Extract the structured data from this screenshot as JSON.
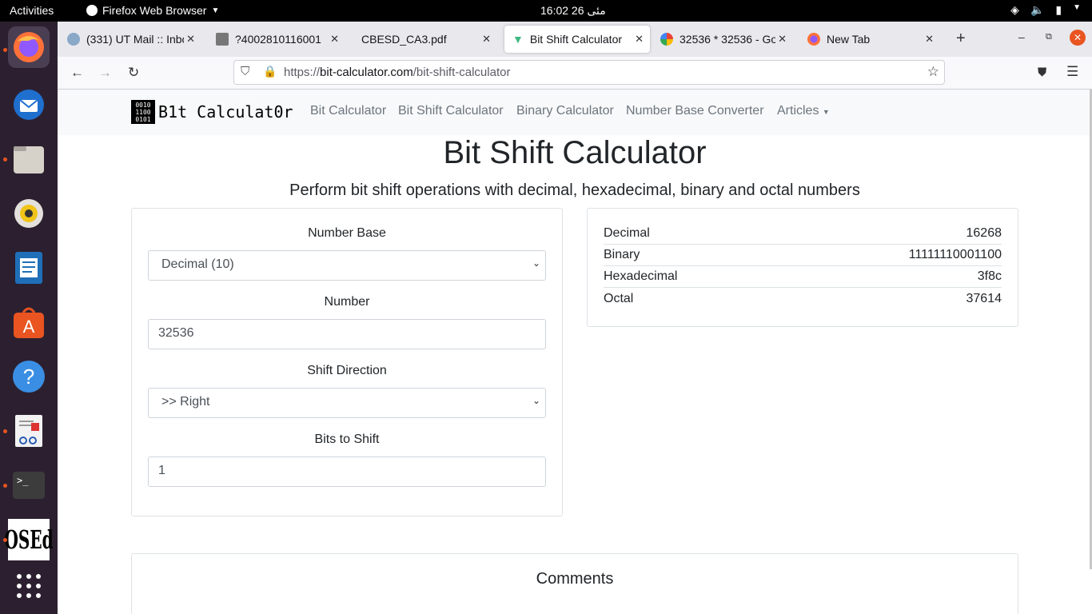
{
  "system": {
    "activities": "Activities",
    "app_name": "Firefox Web Browser",
    "clock": "16:02  26 مئی"
  },
  "tabs": [
    {
      "title": "(331) UT Mail :: Inbo",
      "active": false
    },
    {
      "title": "?4002810116001",
      "active": false
    },
    {
      "title": "CBESD_CA3.pdf",
      "active": false
    },
    {
      "title": "Bit Shift Calculator",
      "active": true
    },
    {
      "title": "32536 * 32536 - Goo",
      "active": false
    },
    {
      "title": "New Tab",
      "active": false
    }
  ],
  "url": {
    "scheme": "https://",
    "host": "bit-calculator.com",
    "path": "/bit-shift-calculator"
  },
  "site": {
    "logo_digits": [
      "0010",
      "1100",
      "0101"
    ],
    "logo_text": "B1t Calculat0r",
    "nav": [
      "Bit Calculator",
      "Bit Shift Calculator",
      "Binary Calculator",
      "Number Base Converter",
      "Articles"
    ]
  },
  "page": {
    "title": "Bit Shift Calculator",
    "subtitle": "Perform bit shift operations with decimal, hexadecimal, binary and octal numbers"
  },
  "form": {
    "base_label": "Number Base",
    "base_value": "Decimal (10)",
    "number_label": "Number",
    "number_value": "32536",
    "direction_label": "Shift Direction",
    "direction_value": ">> Right",
    "bits_label": "Bits to Shift",
    "bits_value": "1"
  },
  "results": [
    {
      "label": "Decimal",
      "value": "16268"
    },
    {
      "label": "Binary",
      "value": "11111110001100"
    },
    {
      "label": "Hexadecimal",
      "value": "3f8c"
    },
    {
      "label": "Octal",
      "value": "37614"
    }
  ],
  "comments": {
    "title": "Comments"
  },
  "colors": {
    "accent": "#e95420",
    "dock": "#2c2030",
    "text": "#212529",
    "muted": "#6c757d"
  }
}
